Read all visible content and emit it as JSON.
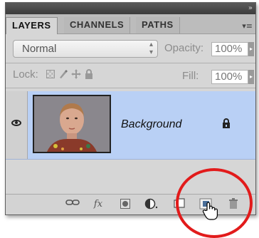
{
  "panel": {
    "tabs": [
      {
        "label": "LAYERS",
        "active": true
      },
      {
        "label": "CHANNELS",
        "active": false
      },
      {
        "label": "PATHS",
        "active": false
      }
    ],
    "collapse_icon": "double-chevron-right-icon",
    "menu_icon": "panel-menu-icon"
  },
  "blend": {
    "mode": "Normal"
  },
  "opacity": {
    "label": "Opacity:",
    "value": "100%"
  },
  "lock": {
    "label": "Lock:",
    "icons": [
      "lock-transparent-pixels-icon",
      "lock-image-pixels-icon",
      "lock-position-icon",
      "lock-all-icon"
    ]
  },
  "fill": {
    "label": "Fill:",
    "value": "100%"
  },
  "layers": [
    {
      "name": "Background",
      "visible": true,
      "locked": true,
      "selected": true
    }
  ],
  "bottom_bar": {
    "buttons": [
      "link-layers-icon",
      "fx-icon",
      "add-mask-icon",
      "adjustment-layer-icon",
      "new-group-icon",
      "new-layer-icon",
      "delete-layer-icon"
    ],
    "fx_label": "fx"
  },
  "colors": {
    "selected_row": "#b9d0f5",
    "highlight_circle": "#e21b1b"
  }
}
